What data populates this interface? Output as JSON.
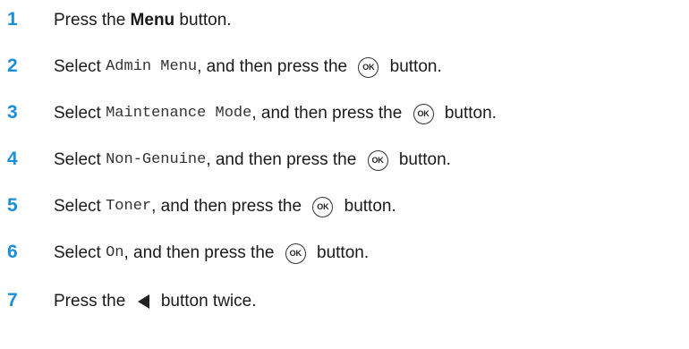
{
  "steps": [
    {
      "number": "1",
      "pre": "Press the ",
      "bold": "Menu",
      "post": " button."
    },
    {
      "number": "2",
      "pre": "Select ",
      "mono": "Admin Menu",
      "mid": ", and then press the ",
      "icon": "OK",
      "post": " button."
    },
    {
      "number": "3",
      "pre": "Select ",
      "mono": "Maintenance Mode",
      "mid": ", and then press the ",
      "icon": "OK",
      "post": " button."
    },
    {
      "number": "4",
      "pre": "Select ",
      "mono": "Non-Genuine",
      "mid": ", and then press the ",
      "icon": "OK",
      "post": " button."
    },
    {
      "number": "5",
      "pre": "Select ",
      "mono": "Toner",
      "mid": ", and then press the ",
      "icon": "OK",
      "post": " button."
    },
    {
      "number": "6",
      "pre": "Select ",
      "mono": "On",
      "mid": ", and then press the ",
      "icon": "OK",
      "post": " button."
    },
    {
      "number": "7",
      "pre": "Press the ",
      "icon_name": "back-arrow-icon",
      "post": " button twice."
    }
  ],
  "colors": {
    "step_number": "#1a8fd9",
    "text": "#1a1a1a"
  }
}
